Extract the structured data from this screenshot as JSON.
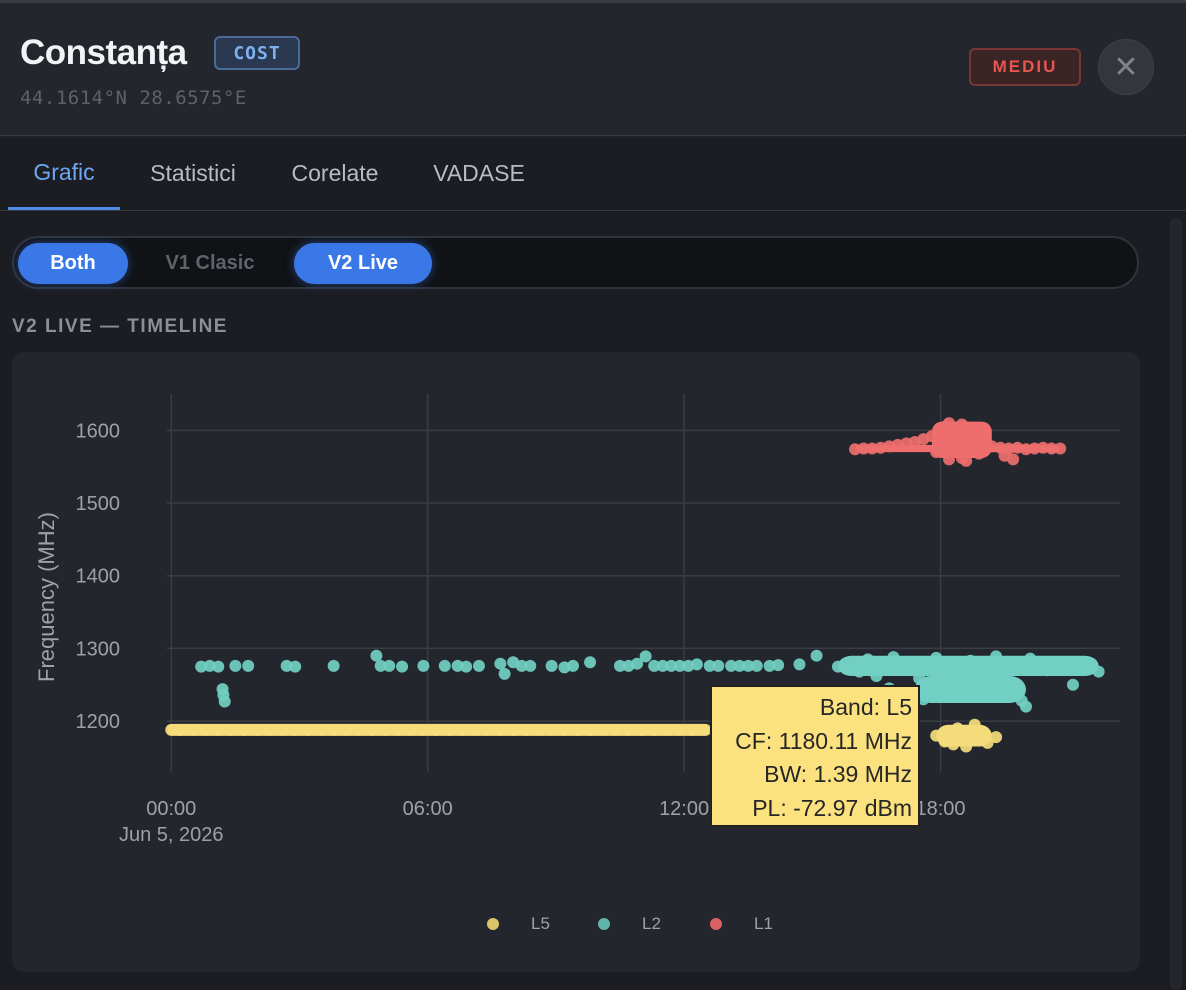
{
  "header": {
    "city": "Constanța",
    "type_badge": "COST",
    "coords": "44.1614°N 28.6575°E",
    "level_badge": "MEDIU",
    "close_label": "✕"
  },
  "tabs": [
    "Grafic",
    "Statistici",
    "Corelate",
    "VADASE"
  ],
  "active_tab": "Grafic",
  "toggle": {
    "options": [
      "Both",
      "V1 Clasic",
      "V2 Live"
    ],
    "active": [
      "Both",
      "V2 Live"
    ]
  },
  "section_title": "V2 LIVE — TIMELINE",
  "chart_data": {
    "type": "scatter",
    "ylabel": "Frequency (MHz)",
    "ylim": [
      1130,
      1650
    ],
    "yticks": [
      1200,
      1300,
      1400,
      1500,
      1600
    ],
    "xlim_hours": [
      -0.1,
      22.2
    ],
    "xticks": [
      {
        "hour": 0,
        "label": "00:00",
        "sublabel": "Jun 5, 2026"
      },
      {
        "hour": 6,
        "label": "06:00",
        "sublabel": ""
      },
      {
        "hour": 12,
        "label": "12:00",
        "sublabel": ""
      },
      {
        "hour": 18,
        "label": "18:00",
        "sublabel": ""
      }
    ],
    "grid": true,
    "legend_position": "bottom-center",
    "series": [
      {
        "name": "L5",
        "color": "#f5dc7a",
        "points": [
          [
            0,
            1188
          ],
          [
            0.2,
            1188
          ],
          [
            0.5,
            1188
          ],
          [
            0.8,
            1188
          ],
          [
            1.1,
            1188
          ],
          [
            1.4,
            1188
          ],
          [
            1.7,
            1188
          ],
          [
            2.0,
            1188
          ],
          [
            2.3,
            1188
          ],
          [
            2.6,
            1188
          ],
          [
            2.9,
            1188
          ],
          [
            3.2,
            1188
          ],
          [
            3.5,
            1188
          ],
          [
            3.8,
            1188
          ],
          [
            4.1,
            1188
          ],
          [
            4.4,
            1188
          ],
          [
            4.7,
            1188
          ],
          [
            5.0,
            1188
          ],
          [
            5.3,
            1188
          ],
          [
            5.6,
            1188
          ],
          [
            5.9,
            1188
          ],
          [
            6.2,
            1188
          ],
          [
            6.5,
            1188
          ],
          [
            6.8,
            1188
          ],
          [
            7.1,
            1188
          ],
          [
            7.4,
            1188
          ],
          [
            7.7,
            1188
          ],
          [
            8.0,
            1188
          ],
          [
            8.3,
            1188
          ],
          [
            8.6,
            1188
          ],
          [
            8.9,
            1188
          ],
          [
            9.2,
            1188
          ],
          [
            9.5,
            1188
          ],
          [
            9.8,
            1188
          ],
          [
            10.1,
            1188
          ],
          [
            10.4,
            1188
          ],
          [
            10.7,
            1188
          ],
          [
            11.0,
            1188
          ],
          [
            11.3,
            1188
          ],
          [
            11.6,
            1188
          ],
          [
            11.9,
            1188
          ],
          [
            12.2,
            1188
          ],
          [
            12.5,
            1188
          ],
          [
            17.9,
            1180
          ],
          [
            18.1,
            1172
          ],
          [
            18.3,
            1168
          ],
          [
            18.5,
            1175
          ],
          [
            18.7,
            1182
          ],
          [
            18.9,
            1176
          ],
          [
            19.1,
            1170
          ],
          [
            18.2,
            1185
          ],
          [
            18.6,
            1165
          ],
          [
            19.3,
            1178
          ],
          [
            18.4,
            1190
          ],
          [
            18.8,
            1195
          ]
        ]
      },
      {
        "name": "L2",
        "color": "#72cfc3",
        "points": [
          [
            0.7,
            1275
          ],
          [
            0.9,
            1276
          ],
          [
            1.1,
            1275
          ],
          [
            1.2,
            1244
          ],
          [
            1.22,
            1236
          ],
          [
            1.25,
            1227
          ],
          [
            1.5,
            1276
          ],
          [
            1.8,
            1276
          ],
          [
            2.7,
            1276
          ],
          [
            2.9,
            1275
          ],
          [
            3.8,
            1276
          ],
          [
            4.8,
            1290
          ],
          [
            4.9,
            1276
          ],
          [
            5.1,
            1276
          ],
          [
            5.4,
            1275
          ],
          [
            5.9,
            1276
          ],
          [
            6.4,
            1276
          ],
          [
            6.7,
            1276
          ],
          [
            6.9,
            1275
          ],
          [
            7.2,
            1276
          ],
          [
            7.7,
            1279
          ],
          [
            7.8,
            1265
          ],
          [
            8.0,
            1281
          ],
          [
            8.2,
            1276
          ],
          [
            8.4,
            1276
          ],
          [
            8.9,
            1276
          ],
          [
            9.2,
            1274
          ],
          [
            9.4,
            1276
          ],
          [
            9.8,
            1281
          ],
          [
            10.5,
            1276
          ],
          [
            10.7,
            1276
          ],
          [
            10.9,
            1279
          ],
          [
            11.1,
            1289
          ],
          [
            11.3,
            1276
          ],
          [
            11.5,
            1276
          ],
          [
            11.7,
            1276
          ],
          [
            11.9,
            1276
          ],
          [
            12.1,
            1276
          ],
          [
            12.3,
            1278
          ],
          [
            12.6,
            1276
          ],
          [
            12.8,
            1276
          ],
          [
            13.1,
            1276
          ],
          [
            13.3,
            1276
          ],
          [
            13.5,
            1276
          ],
          [
            13.7,
            1276
          ],
          [
            14.0,
            1276
          ],
          [
            14.2,
            1277
          ],
          [
            14.7,
            1278
          ],
          [
            15.1,
            1290
          ],
          [
            15.6,
            1275
          ],
          [
            15.9,
            1280
          ],
          [
            16.1,
            1268
          ],
          [
            16.3,
            1285
          ],
          [
            16.5,
            1262
          ],
          [
            16.7,
            1276
          ],
          [
            16.9,
            1288
          ],
          [
            17.1,
            1271
          ],
          [
            17.3,
            1281
          ],
          [
            17.5,
            1259
          ],
          [
            17.7,
            1274
          ],
          [
            17.9,
            1287
          ],
          [
            18.1,
            1265
          ],
          [
            18.3,
            1279
          ],
          [
            18.5,
            1270
          ],
          [
            18.7,
            1283
          ],
          [
            18.9,
            1256
          ],
          [
            19.1,
            1275
          ],
          [
            19.3,
            1289
          ],
          [
            19.5,
            1268
          ],
          [
            19.7,
            1280
          ],
          [
            19.9,
            1273
          ],
          [
            20.1,
            1286
          ],
          [
            20.3,
            1276
          ],
          [
            20.5,
            1270
          ],
          [
            20.7,
            1279
          ],
          [
            20.9,
            1276
          ],
          [
            21.1,
            1272
          ],
          [
            21.3,
            1277
          ],
          [
            21.5,
            1278
          ],
          [
            21.7,
            1268
          ],
          [
            21.1,
            1250
          ],
          [
            19.9,
            1228
          ],
          [
            20.0,
            1220
          ],
          [
            17.6,
            1230
          ],
          [
            18.1,
            1242
          ],
          [
            18.4,
            1236
          ],
          [
            16.8,
            1245
          ],
          [
            17.2,
            1238
          ],
          [
            19.0,
            1244
          ]
        ]
      },
      {
        "name": "L1",
        "color": "#ee6e6e",
        "points": [
          [
            16.0,
            1574
          ],
          [
            16.2,
            1575
          ],
          [
            16.4,
            1575
          ],
          [
            16.6,
            1576
          ],
          [
            16.8,
            1578
          ],
          [
            17.0,
            1580
          ],
          [
            17.2,
            1582
          ],
          [
            17.4,
            1584
          ],
          [
            17.6,
            1588
          ],
          [
            17.8,
            1592
          ],
          [
            18.0,
            1598
          ],
          [
            18.1,
            1605
          ],
          [
            18.2,
            1610
          ],
          [
            18.3,
            1600
          ],
          [
            18.4,
            1590
          ],
          [
            18.5,
            1608
          ],
          [
            18.6,
            1595
          ],
          [
            18.7,
            1585
          ],
          [
            18.8,
            1578
          ],
          [
            18.9,
            1568
          ],
          [
            18.2,
            1560
          ],
          [
            18.5,
            1562
          ],
          [
            19.0,
            1575
          ],
          [
            19.2,
            1578
          ],
          [
            19.4,
            1576
          ],
          [
            19.6,
            1575
          ],
          [
            19.8,
            1576
          ],
          [
            20.0,
            1574
          ],
          [
            20.2,
            1575
          ],
          [
            20.4,
            1576
          ],
          [
            20.6,
            1575
          ],
          [
            20.8,
            1575
          ],
          [
            19.5,
            1565
          ],
          [
            19.7,
            1560
          ],
          [
            17.9,
            1570
          ],
          [
            18.6,
            1558
          ]
        ]
      }
    ],
    "tooltip": {
      "lines": [
        "Band: L5",
        "CF: 1180.11 MHz",
        "BW: 1.39 MHz",
        "PL: -72.97 dBm"
      ]
    }
  }
}
